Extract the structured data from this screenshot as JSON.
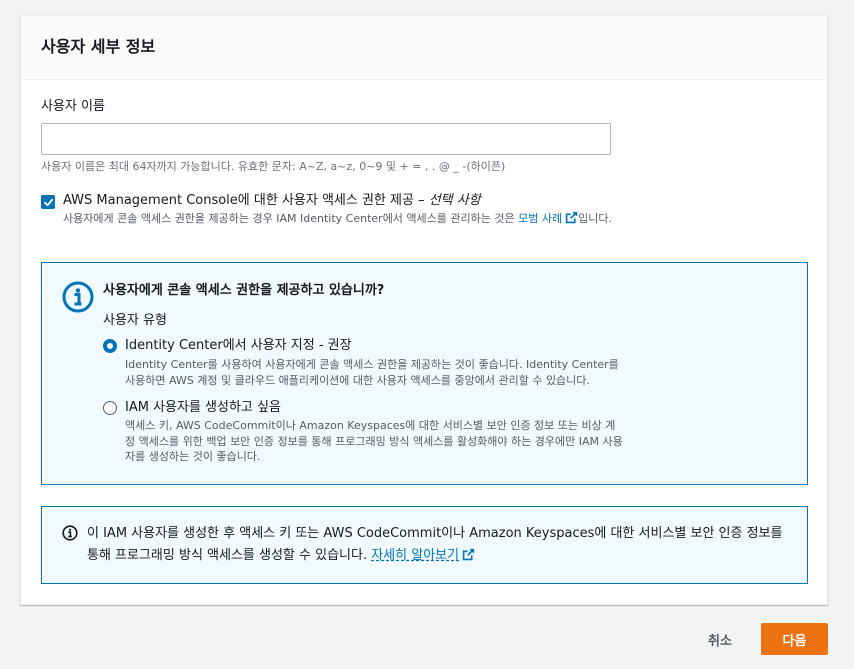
{
  "section": {
    "title": "사용자 세부 정보"
  },
  "username_field": {
    "label": "사용자 이름",
    "value": "",
    "hint": "사용자 이름은 최대 64자까지 가능합니다. 유효한 문자: A~Z, a~z, 0~9 및 + = , . @ _ -(하이픈)"
  },
  "console_access": {
    "checked": true,
    "label": "AWS Management Console에 대한 사용자 액세스 권한 제공 – ",
    "label_optional": "선택 사항",
    "desc_prefix": "사용자에게 콘솔 액세스 권한을 제공하는 경우 IAM Identity Center에서 액세스를 관리하는 것은 ",
    "desc_link": "모범 사례",
    "desc_suffix": "입니다."
  },
  "info_box": {
    "title": "사용자에게 콘솔 액세스 권한을 제공하고 있습니까?",
    "user_type_label": "사용자 유형",
    "options": [
      {
        "title": "Identity Center에서 사용자 지정 - 권장",
        "desc": "Identity Center를 사용하여 사용자에게 콘솔 액세스 권한을 제공하는 것이 좋습니다. Identity Center를 사용하면 AWS 계정 및 클라우드 애플리케이션에 대한 사용자 액세스를 중앙에서 관리할 수 있습니다.",
        "selected": true
      },
      {
        "title": "IAM 사용자를 생성하고 싶음",
        "desc": "액세스 키, AWS CodeCommit이나 Amazon Keyspaces에 대한 서비스별 보안 인증 정보 또는 비상 계정 액세스를 위한 백업 보안 인증 정보를 통해 프로그래밍 방식 액세스를 활성화해야 하는 경우에만 IAM 사용자를 생성하는 것이 좋습니다.",
        "selected": false
      }
    ]
  },
  "info_box2": {
    "text": "이 IAM 사용자를 생성한 후 액세스 키 또는 AWS CodeCommit이나 Amazon Keyspaces에 대한 서비스별 보안 인증 정보를 통해 프로그래밍 방식 액세스를 생성할 수 있습니다. ",
    "link": "자세히 알아보기"
  },
  "footer": {
    "cancel_label": "취소",
    "next_label": "다음"
  },
  "colors": {
    "accent": "#0073bb",
    "primary_button": "#ec7211",
    "info_background": "#f1faff"
  },
  "icons": [
    "info-icon",
    "external-link-icon",
    "check-icon"
  ]
}
